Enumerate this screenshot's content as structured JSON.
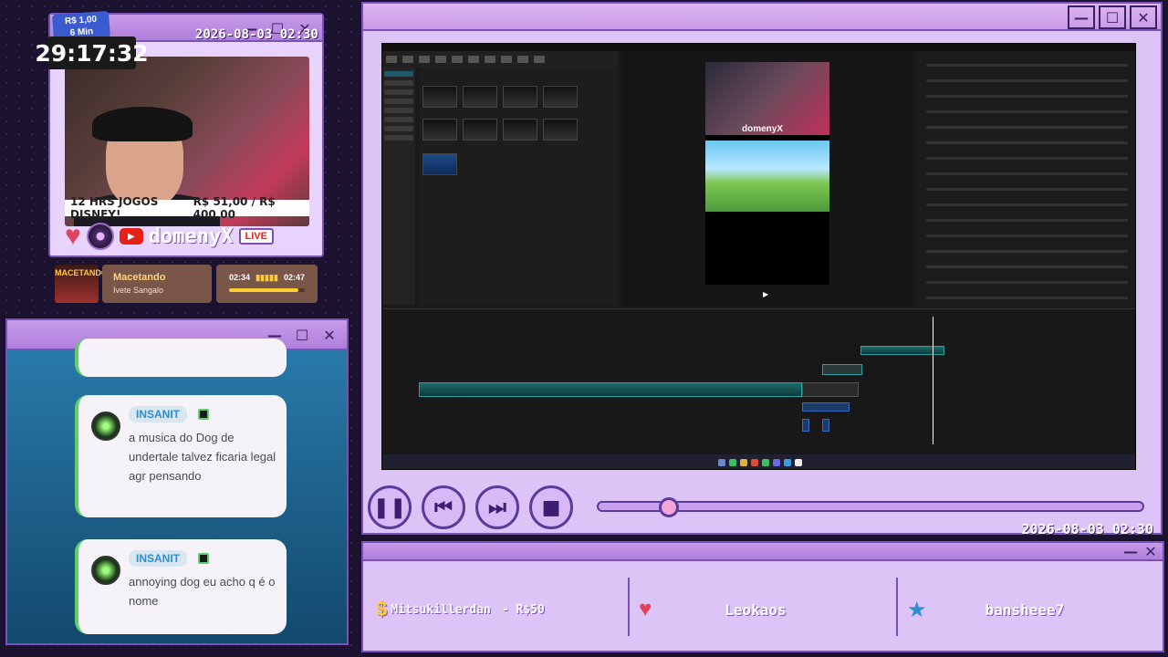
{
  "webcam_window": {
    "donation_badge": {
      "amount": "R$ 1,00",
      "duration": "6 Min"
    },
    "timer": "29:17:32",
    "datetime": "2026-08-03 02:30",
    "promo": {
      "left": "12 HRS JOGOS DISNEY!",
      "right": "R$ 51,00 / R$ 400,00"
    },
    "brand": "domenyX",
    "live_label": "LIVE"
  },
  "music": {
    "cover_text": "MACETANDO",
    "title": "Macetando",
    "artist": "Ivete Sangalo",
    "elapsed": "02:34",
    "total": "02:47",
    "progress": 0.92
  },
  "chat": {
    "messages": [
      {
        "user": "INSANIT",
        "text": "a musica do Dog de undertale talvez ficaria legal agr pensando"
      },
      {
        "user": "INSANIT",
        "text": "annoying dog eu acho q é o nome"
      }
    ]
  },
  "editor": {
    "preview_brand": "domenyX",
    "datetime": "2026-08-03 02:30",
    "seek_progress": 0.13,
    "controls": [
      "pause-icon",
      "skip-back-icon",
      "skip-forward-icon",
      "stop-icon"
    ]
  },
  "alerts": {
    "donation": {
      "user": "Mitsukillerdan",
      "amount": "- R$50"
    },
    "follower": {
      "user": "Leokaos"
    },
    "subscriber": {
      "user": "bansheee7"
    }
  },
  "colors": {
    "accent": "#b07fdc",
    "border": "#7b50b8",
    "heart": "#e0435d",
    "star": "#2b8fd0"
  }
}
